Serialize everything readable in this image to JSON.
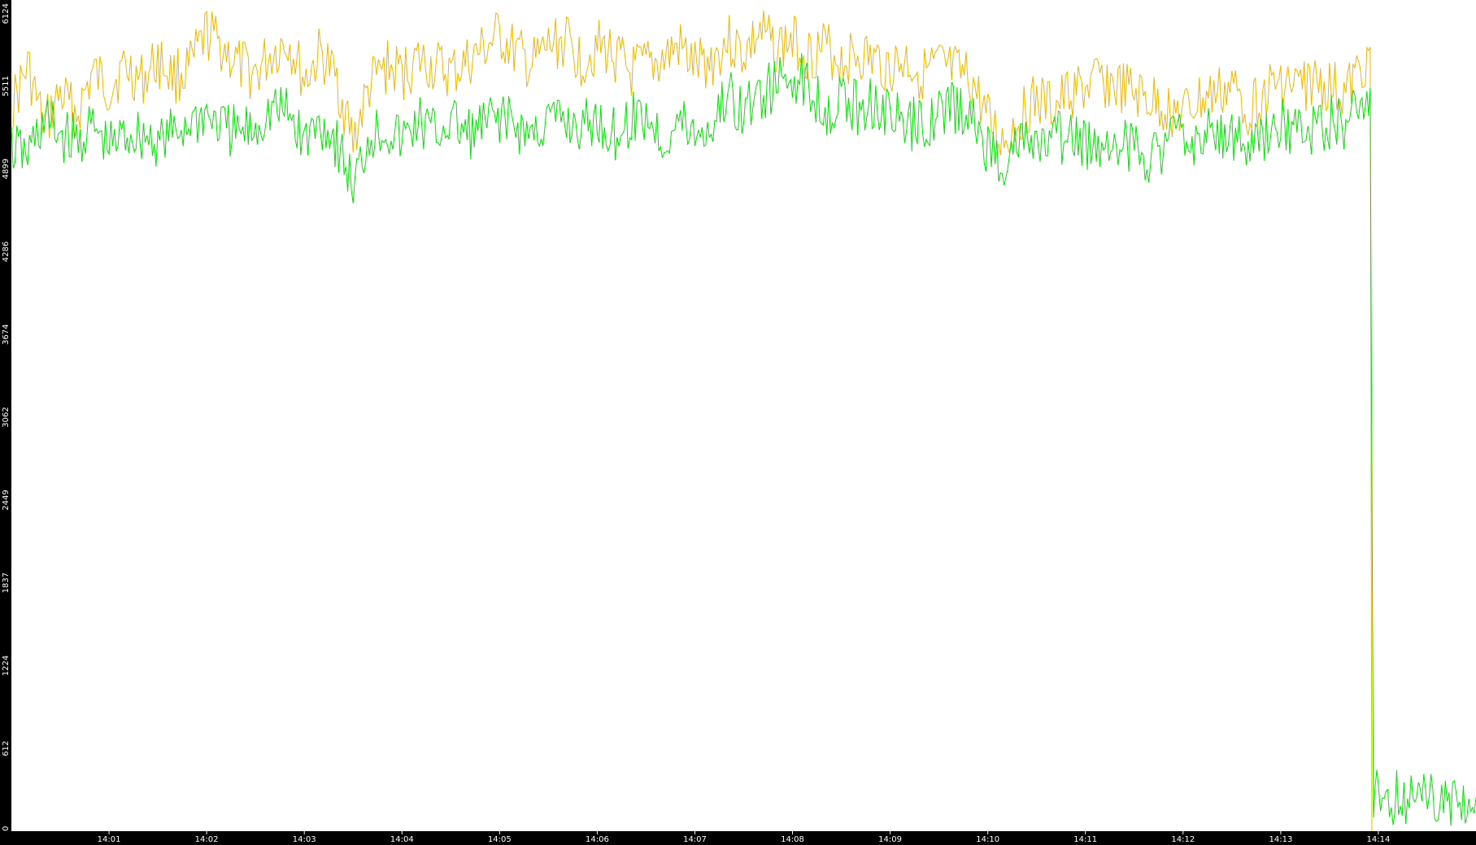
{
  "chart_data": {
    "type": "line",
    "title": "",
    "xlabel": "",
    "ylabel": "",
    "ylim": [
      0,
      6124
    ],
    "xlim": [
      "14:00:00",
      "14:15:00"
    ],
    "grid": false,
    "legend": "none",
    "y_ticks": [
      "0",
      "612",
      "1224",
      "1837",
      "2449",
      "3062",
      "3674",
      "4286",
      "4899",
      "5511",
      "6124"
    ],
    "x_ticks": [
      {
        "t": "14:01:00",
        "label": "14:01"
      },
      {
        "t": "14:02:00",
        "label": "14:02"
      },
      {
        "t": "14:03:00",
        "label": "14:03"
      },
      {
        "t": "14:04:00",
        "label": "14:04"
      },
      {
        "t": "14:05:00",
        "label": "14:05"
      },
      {
        "t": "14:06:00",
        "label": "14:06"
      },
      {
        "t": "14:07:00",
        "label": "14:07"
      },
      {
        "t": "14:08:00",
        "label": "14:08"
      },
      {
        "t": "14:09:00",
        "label": "14:09"
      },
      {
        "t": "14:10:00",
        "label": "14:10"
      },
      {
        "t": "14:11:00",
        "label": "14:11"
      },
      {
        "t": "14:12:00",
        "label": "14:12"
      },
      {
        "t": "14:13:00",
        "label": "14:13"
      },
      {
        "t": "14:14:00",
        "label": "14:14"
      }
    ],
    "series": [
      {
        "color": "#f5b400",
        "points": [
          [
            "14:00:00",
            5350
          ],
          [
            "14:00:10",
            5650
          ],
          [
            "14:00:20",
            5200
          ],
          [
            "14:00:30",
            5450
          ],
          [
            "14:00:40",
            5300
          ],
          [
            "14:00:50",
            5600
          ],
          [
            "14:01:00",
            5500
          ],
          [
            "14:01:10",
            5650
          ],
          [
            "14:01:20",
            5550
          ],
          [
            "14:01:30",
            5700
          ],
          [
            "14:01:40",
            5580
          ],
          [
            "14:01:50",
            5640
          ],
          [
            "14:02:00",
            5900
          ],
          [
            "14:02:10",
            5800
          ],
          [
            "14:02:20",
            5650
          ],
          [
            "14:02:30",
            5600
          ],
          [
            "14:02:40",
            5750
          ],
          [
            "14:02:50",
            5850
          ],
          [
            "14:03:00",
            5550
          ],
          [
            "14:03:10",
            5750
          ],
          [
            "14:03:20",
            5550
          ],
          [
            "14:03:30",
            5100
          ],
          [
            "14:03:40",
            5500
          ],
          [
            "14:03:50",
            5650
          ],
          [
            "14:04:00",
            5600
          ],
          [
            "14:04:10",
            5700
          ],
          [
            "14:04:20",
            5650
          ],
          [
            "14:04:30",
            5600
          ],
          [
            "14:04:40",
            5680
          ],
          [
            "14:04:50",
            5780
          ],
          [
            "14:05:00",
            5880
          ],
          [
            "14:05:10",
            5750
          ],
          [
            "14:05:20",
            5650
          ],
          [
            "14:05:30",
            5800
          ],
          [
            "14:05:40",
            5850
          ],
          [
            "14:05:50",
            5700
          ],
          [
            "14:06:00",
            5800
          ],
          [
            "14:06:10",
            5750
          ],
          [
            "14:06:20",
            5600
          ],
          [
            "14:06:30",
            5650
          ],
          [
            "14:06:40",
            5700
          ],
          [
            "14:06:50",
            5800
          ],
          [
            "14:07:00",
            5650
          ],
          [
            "14:07:10",
            5700
          ],
          [
            "14:07:20",
            5850
          ],
          [
            "14:07:30",
            5750
          ],
          [
            "14:07:40",
            5900
          ],
          [
            "14:07:50",
            5800
          ],
          [
            "14:08:00",
            5850
          ],
          [
            "14:08:10",
            5750
          ],
          [
            "14:08:20",
            5800
          ],
          [
            "14:08:30",
            5700
          ],
          [
            "14:08:40",
            5750
          ],
          [
            "14:08:50",
            5700
          ],
          [
            "14:09:00",
            5650
          ],
          [
            "14:09:10",
            5700
          ],
          [
            "14:09:20",
            5600
          ],
          [
            "14:09:30",
            5650
          ],
          [
            "14:09:40",
            5600
          ],
          [
            "14:09:50",
            5550
          ],
          [
            "14:10:00",
            5250
          ],
          [
            "14:10:10",
            5100
          ],
          [
            "14:10:20",
            5300
          ],
          [
            "14:10:30",
            5400
          ],
          [
            "14:10:40",
            5350
          ],
          [
            "14:10:50",
            5450
          ],
          [
            "14:11:00",
            5500
          ],
          [
            "14:11:10",
            5550
          ],
          [
            "14:11:20",
            5500
          ],
          [
            "14:11:30",
            5450
          ],
          [
            "14:11:40",
            5400
          ],
          [
            "14:11:50",
            5350
          ],
          [
            "14:12:00",
            5300
          ],
          [
            "14:12:10",
            5400
          ],
          [
            "14:12:20",
            5450
          ],
          [
            "14:12:30",
            5500
          ],
          [
            "14:12:40",
            5350
          ],
          [
            "14:12:50",
            5450
          ],
          [
            "14:13:00",
            5550
          ],
          [
            "14:13:10",
            5500
          ],
          [
            "14:13:20",
            5550
          ],
          [
            "14:13:30",
            5500
          ],
          [
            "14:13:40",
            5450
          ],
          [
            "14:13:50",
            5650
          ],
          [
            "14:13:55",
            5800
          ],
          [
            "14:13:56",
            0
          ]
        ]
      },
      {
        "color": "#00e600",
        "points": [
          [
            "14:00:00",
            5050
          ],
          [
            "14:00:10",
            5000
          ],
          [
            "14:00:20",
            5250
          ],
          [
            "14:00:30",
            5150
          ],
          [
            "14:00:40",
            5100
          ],
          [
            "14:00:50",
            5200
          ],
          [
            "14:01:00",
            5050
          ],
          [
            "14:01:10",
            5150
          ],
          [
            "14:01:20",
            5150
          ],
          [
            "14:01:30",
            5100
          ],
          [
            "14:01:40",
            5150
          ],
          [
            "14:01:50",
            5250
          ],
          [
            "14:02:00",
            5300
          ],
          [
            "14:02:10",
            5200
          ],
          [
            "14:02:20",
            5150
          ],
          [
            "14:02:30",
            5200
          ],
          [
            "14:02:40",
            5350
          ],
          [
            "14:02:50",
            5300
          ],
          [
            "14:03:00",
            5100
          ],
          [
            "14:03:10",
            5250
          ],
          [
            "14:03:20",
            5100
          ],
          [
            "14:03:30",
            4750
          ],
          [
            "14:03:40",
            5150
          ],
          [
            "14:03:50",
            5200
          ],
          [
            "14:04:00",
            5100
          ],
          [
            "14:04:10",
            5250
          ],
          [
            "14:04:20",
            5150
          ],
          [
            "14:04:30",
            5250
          ],
          [
            "14:04:40",
            5150
          ],
          [
            "14:04:50",
            5200
          ],
          [
            "14:05:00",
            5300
          ],
          [
            "14:05:10",
            5200
          ],
          [
            "14:05:20",
            5150
          ],
          [
            "14:05:30",
            5250
          ],
          [
            "14:05:40",
            5250
          ],
          [
            "14:05:50",
            5200
          ],
          [
            "14:06:00",
            5250
          ],
          [
            "14:06:10",
            5150
          ],
          [
            "14:06:20",
            5250
          ],
          [
            "14:06:30",
            5300
          ],
          [
            "14:06:40",
            5100
          ],
          [
            "14:06:50",
            5250
          ],
          [
            "14:07:00",
            5150
          ],
          [
            "14:07:10",
            5200
          ],
          [
            "14:07:20",
            5450
          ],
          [
            "14:07:30",
            5300
          ],
          [
            "14:07:40",
            5450
          ],
          [
            "14:07:50",
            5500
          ],
          [
            "14:08:00",
            5600
          ],
          [
            "14:08:10",
            5500
          ],
          [
            "14:08:20",
            5350
          ],
          [
            "14:08:30",
            5400
          ],
          [
            "14:08:40",
            5350
          ],
          [
            "14:08:50",
            5400
          ],
          [
            "14:09:00",
            5300
          ],
          [
            "14:09:10",
            5200
          ],
          [
            "14:09:20",
            5250
          ],
          [
            "14:09:30",
            5300
          ],
          [
            "14:09:40",
            5350
          ],
          [
            "14:09:50",
            5250
          ],
          [
            "14:10:00",
            5050
          ],
          [
            "14:10:10",
            4950
          ],
          [
            "14:10:20",
            5100
          ],
          [
            "14:10:30",
            5050
          ],
          [
            "14:10:40",
            5100
          ],
          [
            "14:10:50",
            5150
          ],
          [
            "14:11:00",
            5050
          ],
          [
            "14:11:10",
            5100
          ],
          [
            "14:11:20",
            5100
          ],
          [
            "14:11:30",
            5050
          ],
          [
            "14:11:40",
            5000
          ],
          [
            "14:11:50",
            5100
          ],
          [
            "14:12:00",
            5150
          ],
          [
            "14:12:10",
            5100
          ],
          [
            "14:12:20",
            5200
          ],
          [
            "14:12:30",
            5150
          ],
          [
            "14:12:40",
            5050
          ],
          [
            "14:12:50",
            5100
          ],
          [
            "14:13:00",
            5250
          ],
          [
            "14:13:10",
            5150
          ],
          [
            "14:13:20",
            5200
          ],
          [
            "14:13:30",
            5250
          ],
          [
            "14:13:40",
            5200
          ],
          [
            "14:13:50",
            5400
          ],
          [
            "14:13:55",
            5500
          ],
          [
            "14:13:56",
            2750
          ],
          [
            "14:13:57",
            100
          ],
          [
            "14:13:58",
            250
          ],
          [
            "14:15:00",
            250
          ]
        ]
      }
    ]
  }
}
